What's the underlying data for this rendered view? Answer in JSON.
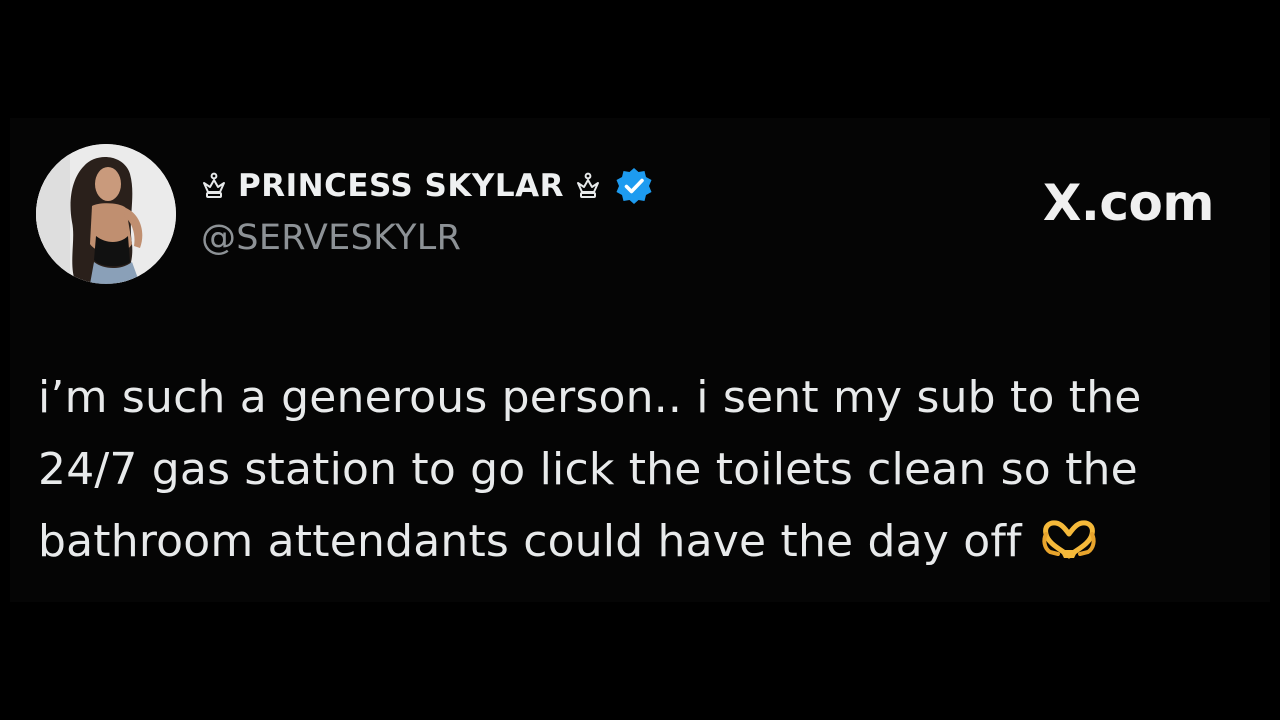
{
  "tweet": {
    "author": {
      "display_name": "PRINCESS SKYLAR",
      "name_prefix_icon": "crown-icon",
      "name_suffix_icon": "crown-icon",
      "verified": true,
      "verified_color": "#1d9bf0",
      "handle": "@SERVESKYLR",
      "avatar": "profile-photo"
    },
    "brand": "X.com",
    "text_lines": [
      "i’m such a generous person.. i sent my sub to the",
      "24/7 gas station to go lick the toilets clean so the",
      "bathroom attendants could have the day off"
    ],
    "trailing_emoji": "heart-hands-emoji"
  },
  "colors": {
    "background": "#000000",
    "text": "#e8eaeb",
    "handle": "#8d9296",
    "emoji": "#f5b93a"
  }
}
